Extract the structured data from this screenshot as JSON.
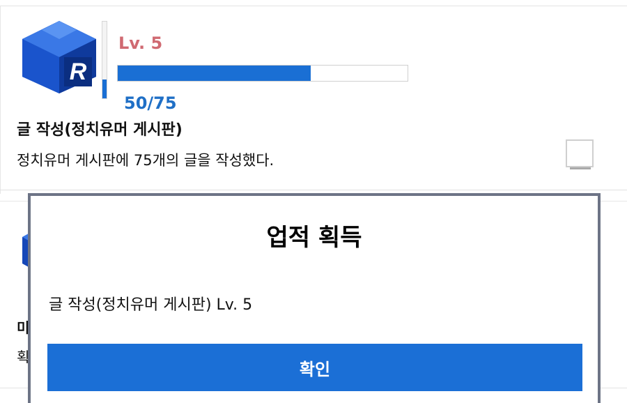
{
  "achievement": {
    "level": "Lv. 5",
    "progress_text": "50/75",
    "progress_fraction": 0.6667,
    "level_bar_fraction": 0.25,
    "title": "글 작성(정치유머 게시판)",
    "description": "정치유머 게시판에 75개의 글을 작성했다.",
    "badge_letter": "R",
    "checked": false
  },
  "second_card": {
    "title_peek": "미",
    "desc_peek": "획"
  },
  "modal": {
    "title": "업적 획득",
    "body": "글 작성(정치유머 게시판) Lv. 5",
    "confirm_label": "확인"
  },
  "colors": {
    "accent": "#1b6fd6",
    "level_text": "#d06a72",
    "progress_text": "#1f6fc6",
    "modal_border": "#6d7486"
  }
}
